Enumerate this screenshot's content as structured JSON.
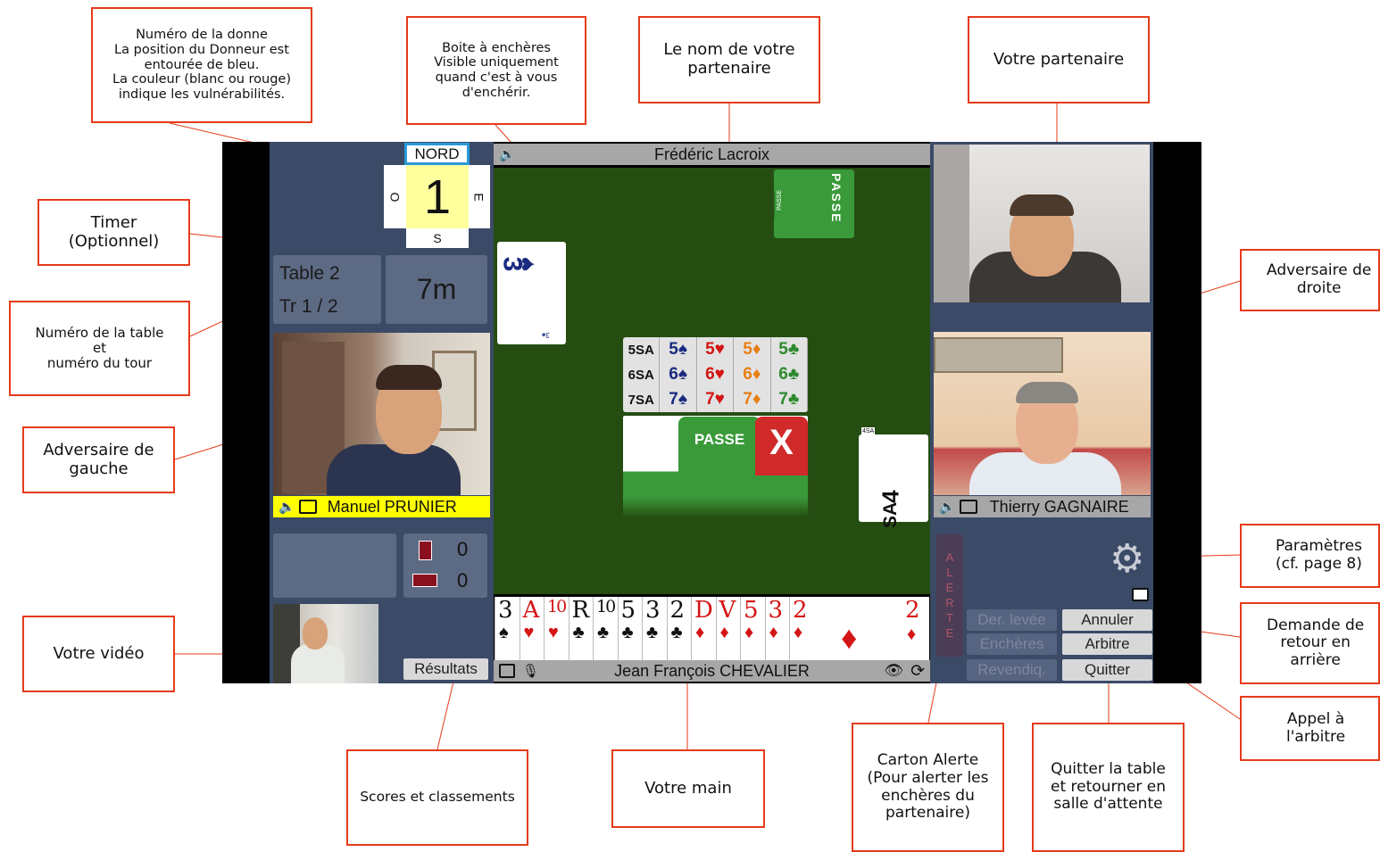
{
  "board": {
    "north_label": "NORD",
    "west_label": "O",
    "east_label": "E",
    "south_label": "S",
    "deal_number": "1"
  },
  "table_info": {
    "table": "Table 2",
    "round": "Tr 1 / 2",
    "timer": "7m"
  },
  "players": {
    "partner": "Frédéric Lacroix",
    "left": "Manuel PRUNIER",
    "right": "Thierry GAGNAIRE",
    "self": "Jean François CHEVALIER"
  },
  "score": {
    "ns": "0",
    "ew": "0"
  },
  "buttons": {
    "results": "Résultats",
    "last_trick": "Der. levée",
    "undo": "Annuler",
    "bids": "Enchères",
    "referee": "Arbitre",
    "claim": "Revendiq.",
    "quit": "Quitter"
  },
  "alert_card": "ALERTE",
  "bids": {
    "partner_card": "PASSE",
    "partner_small": "PASSE",
    "left_card_rank": "3",
    "left_card_suit": "♠",
    "left_card_small": "3♠",
    "right_card_rank": "4",
    "right_card_suit": "SA",
    "right_card_small": "4SA"
  },
  "bidding_box": {
    "rows": [
      [
        "5SA",
        "5♠",
        "5♥",
        "5♦",
        "5♣"
      ],
      [
        "6SA",
        "6♠",
        "6♥",
        "6♦",
        "6♣"
      ],
      [
        "7SA",
        "7♠",
        "7♥",
        "7♦",
        "7♣"
      ]
    ],
    "pass": "PASSE",
    "double": "X"
  },
  "hand": [
    {
      "rank": "3",
      "suit": "♠",
      "color": "black"
    },
    {
      "rank": "A",
      "suit": "♥",
      "color": "red"
    },
    {
      "rank": "10",
      "suit": "♥",
      "color": "red"
    },
    {
      "rank": "R",
      "suit": "♣",
      "color": "black"
    },
    {
      "rank": "10",
      "suit": "♣",
      "color": "black"
    },
    {
      "rank": "5",
      "suit": "♣",
      "color": "black"
    },
    {
      "rank": "3",
      "suit": "♣",
      "color": "black"
    },
    {
      "rank": "2",
      "suit": "♣",
      "color": "black"
    },
    {
      "rank": "D",
      "suit": "♦",
      "color": "red"
    },
    {
      "rank": "V",
      "suit": "♦",
      "color": "red"
    },
    {
      "rank": "5",
      "suit": "♦",
      "color": "red"
    },
    {
      "rank": "3",
      "suit": "♦",
      "color": "red"
    },
    {
      "rank": "2",
      "suit": "♦",
      "color": "red"
    }
  ],
  "callouts": {
    "deal": "Numéro de la donne\nLa position du Donneur est\nentourée de bleu.\nLa couleur (blanc ou rouge)\nindique les vulnérabilités.",
    "bidbox": "Boite à enchères\nVisible uniquement\nquand c'est à vous\nd'enchérir.",
    "partner_name": "Le nom de votre\npartenaire",
    "partner": "Votre partenaire",
    "timer": "Timer\n(Optionnel)",
    "table": "Numéro de la table\net\nnuméro du tour",
    "left_opp": "Adversaire de\ngauche",
    "right_opp": "Adversaire de\ndroite",
    "settings": "Paramètres\n(cf. page 8)",
    "undo": "Demande de\nretour en\narrière",
    "referee": "Appel à\nl'arbitre",
    "video": "Votre vidéo",
    "scores": "Scores et classements",
    "hand": "Votre main",
    "alert": "Carton Alerte\n(Pour alerter les\nenchères du\npartenaire)",
    "quit": "Quitter la table\net retourner en\nsalle d'attente"
  },
  "colors": {
    "accent": "#e63b1a",
    "felt": "#254d12",
    "panel": "#3b4a66",
    "name_highlight": "#ffff00",
    "pass_green": "#3a9a3a"
  }
}
